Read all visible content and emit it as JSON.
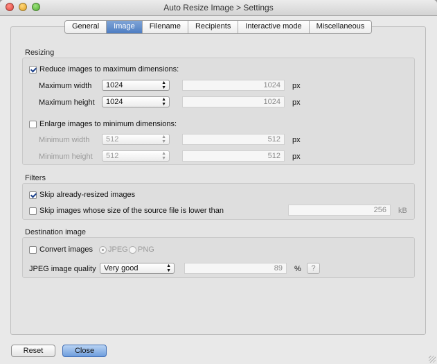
{
  "window": {
    "title": "Auto Resize Image > Settings"
  },
  "tabs": [
    {
      "label": "General"
    },
    {
      "label": "Image",
      "active": true
    },
    {
      "label": "Filename"
    },
    {
      "label": "Recipients"
    },
    {
      "label": "Interactive mode"
    },
    {
      "label": "Miscellaneous"
    }
  ],
  "resizing": {
    "title": "Resizing",
    "reduce": {
      "label": "Reduce images to maximum dimensions:",
      "checked": true
    },
    "max_width": {
      "label": "Maximum width",
      "select": "1024",
      "value": "1024",
      "unit": "px"
    },
    "max_height": {
      "label": "Maximum height",
      "select": "1024",
      "value": "1024",
      "unit": "px"
    },
    "enlarge": {
      "label": "Enlarge images to minimum dimensions:",
      "checked": false
    },
    "min_width": {
      "label": "Minimum width",
      "select": "512",
      "value": "512",
      "unit": "px"
    },
    "min_height": {
      "label": "Minimum height",
      "select": "512",
      "value": "512",
      "unit": "px"
    }
  },
  "filters": {
    "title": "Filters",
    "skip_resized": {
      "label": "Skip already-resized images",
      "checked": true
    },
    "skip_small": {
      "label": "Skip images whose size of the source file is lower than",
      "checked": false,
      "value": "256",
      "unit": "kB"
    }
  },
  "destination": {
    "title": "Destination image",
    "convert": {
      "label": "Convert images",
      "checked": false
    },
    "format_options": [
      {
        "label": "JPEG",
        "selected": true
      },
      {
        "label": "PNG",
        "selected": false
      }
    ],
    "quality": {
      "label": "JPEG image quality",
      "select": "Very good",
      "value": "89",
      "unit": "%",
      "help": "?"
    }
  },
  "footer": {
    "reset": "Reset",
    "close": "Close"
  }
}
